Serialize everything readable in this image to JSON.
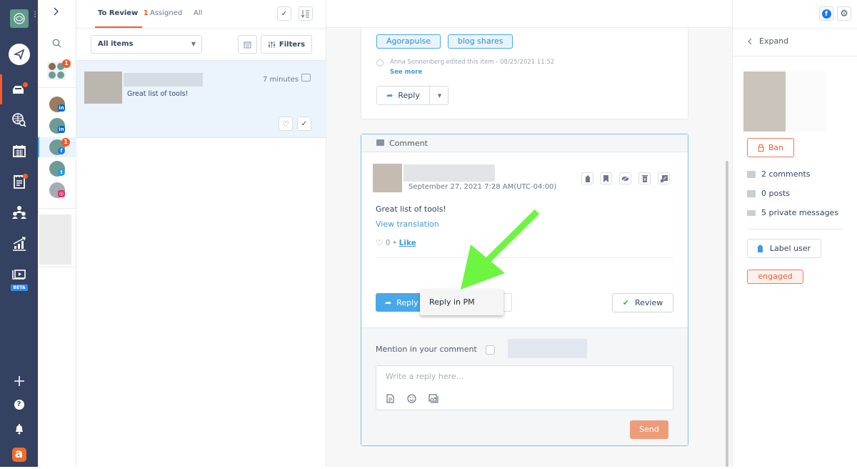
{
  "nav": {
    "items": [
      {
        "name": "publish",
        "icon": "paper-plane-icon"
      },
      {
        "name": "inbox",
        "icon": "inbox-icon",
        "active": true,
        "notification": true
      },
      {
        "name": "listening",
        "icon": "globe-search-icon"
      },
      {
        "name": "calendar",
        "icon": "calendar-icon"
      },
      {
        "name": "reports-list",
        "icon": "clipboard-icon",
        "notification": true
      },
      {
        "name": "users",
        "icon": "team-icon"
      },
      {
        "name": "reports",
        "icon": "chart-icon"
      },
      {
        "name": "media",
        "icon": "media-library-icon",
        "badge": "BETA"
      }
    ],
    "bottom": [
      {
        "name": "add",
        "icon": "plus-icon"
      },
      {
        "name": "help",
        "icon": "help-icon"
      },
      {
        "name": "notifications",
        "icon": "bell-icon"
      },
      {
        "name": "account",
        "icon": "agorapulse-logo-icon"
      }
    ]
  },
  "profiles": {
    "group_badge": "1",
    "items": [
      {
        "network": "linkedin",
        "badge": ""
      },
      {
        "network": "linkedin",
        "badge": ""
      },
      {
        "network": "facebook",
        "badge": "1",
        "active": true
      },
      {
        "network": "twitter",
        "badge": ""
      },
      {
        "network": "instagram",
        "badge": ""
      }
    ]
  },
  "list": {
    "tabs": [
      {
        "label": "To Review",
        "count": "1",
        "active": true
      },
      {
        "label": "Assigned"
      },
      {
        "label": "All"
      }
    ],
    "filter_select": "All items",
    "filters_label": "Filters",
    "items": [
      {
        "text": "Great list of tools!",
        "time": "7 minutes"
      }
    ]
  },
  "post": {
    "tags": [
      "Agorapulse",
      "blog shares"
    ],
    "history": "Anna Sonnenberg edited this item - 08/25/2021 11:52",
    "see_more": "See more",
    "reply_label": "Reply"
  },
  "comment": {
    "header": "Comment",
    "date": "September 27, 2021 7:28 AM(UTC-04:00)",
    "text": "Great list of tools!",
    "view_translation": "View translation",
    "likes": "0",
    "like_label": "Like",
    "reply_label": "Reply",
    "dropdown_option": "Reply in PM",
    "review_label": "Review",
    "mention_label": "Mention in your comment",
    "reply_placeholder": "Write a reply here...",
    "send_label": "Send"
  },
  "right": {
    "expand_label": "Expand",
    "ban_label": "Ban",
    "stats": [
      {
        "icon": "comment-icon",
        "label": "2 comments"
      },
      {
        "icon": "post-icon",
        "label": "0 posts"
      },
      {
        "icon": "mail-icon",
        "label": "5 private messages"
      }
    ],
    "label_user": "Label user",
    "labels": [
      "engaged"
    ]
  },
  "colors": {
    "accent": "#ff5a26",
    "primary": "#4aa9e9",
    "nav_bg": "#344161",
    "annotation_arrow": "#6ef542"
  }
}
